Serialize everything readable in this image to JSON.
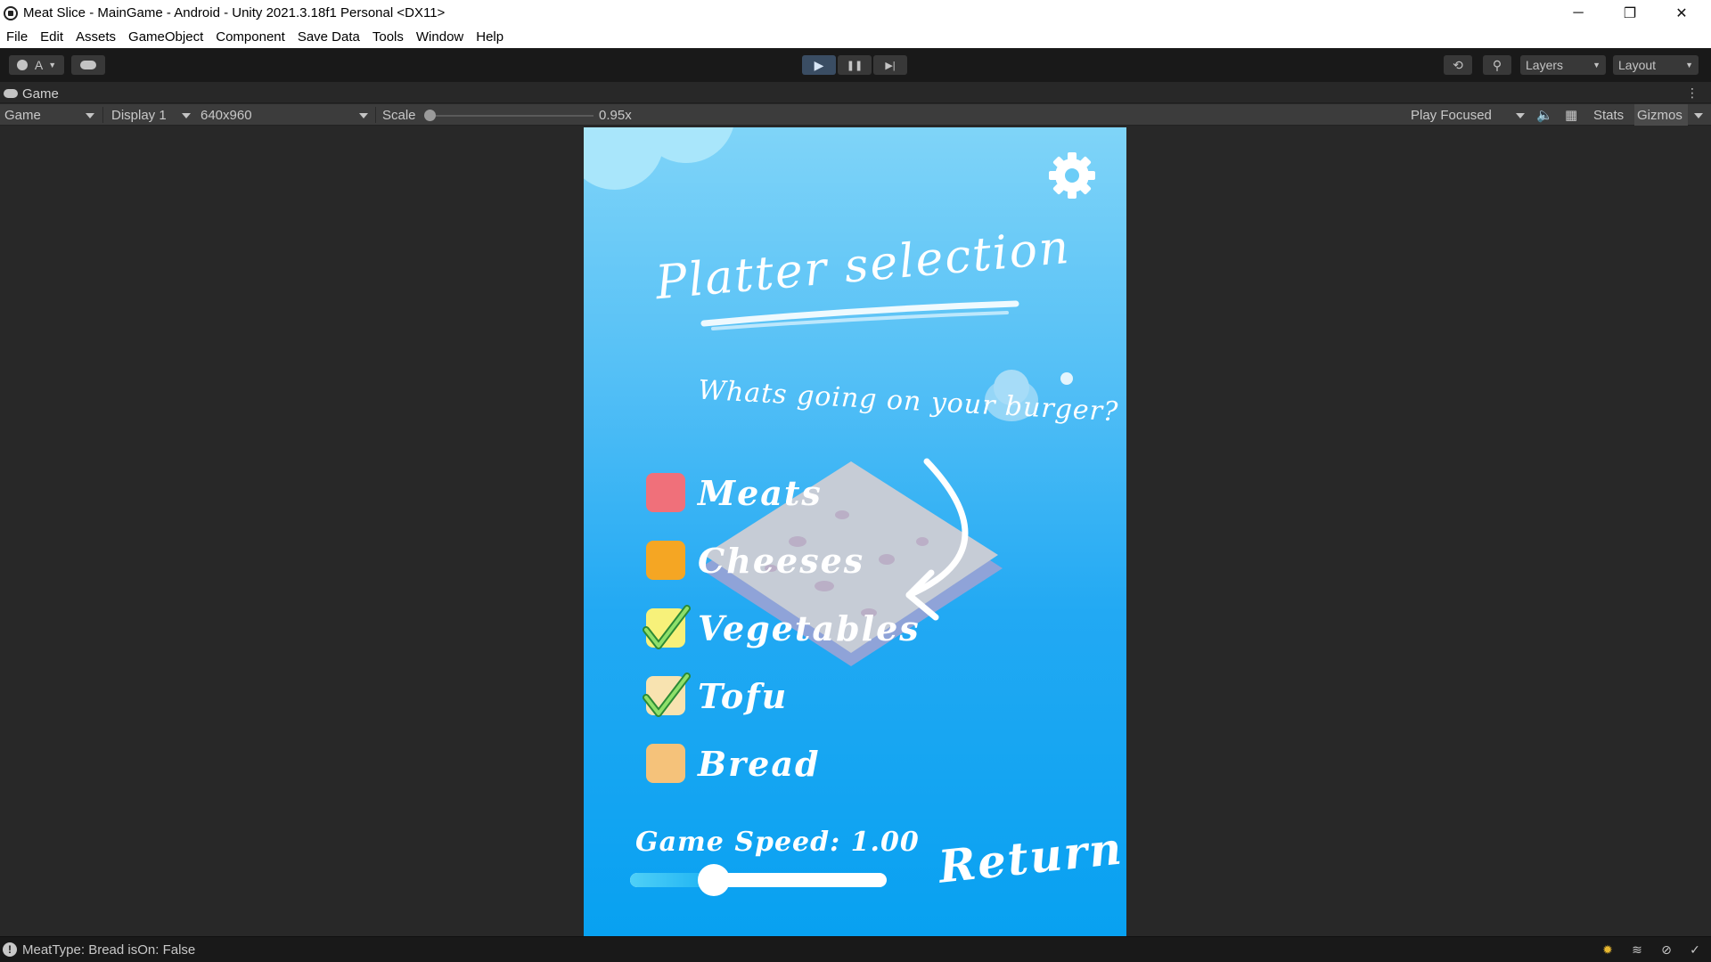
{
  "window": {
    "title": "Meat Slice - MainGame - Android - Unity 2021.3.18f1 Personal <DX11>",
    "controls": {
      "minimize": "─",
      "maximize": "❐",
      "close": "✕"
    }
  },
  "menu": [
    "File",
    "Edit",
    "Assets",
    "GameObject",
    "Component",
    "Save Data",
    "Tools",
    "Window",
    "Help"
  ],
  "toolbar": {
    "account_label": "A",
    "layers_label": "Layers",
    "layout_label": "Layout",
    "play_glyph": "▶",
    "pause_glyph": "❚❚",
    "step_glyph": "▶|"
  },
  "game_tab": {
    "label": "Game"
  },
  "game_toolbar": {
    "view_mode": "Game",
    "display": "Display 1",
    "resolution": "640x960",
    "scale_label": "Scale",
    "scale_value": "0.95x",
    "play_focused": "Play Focused",
    "stats_label": "Stats",
    "gizmos_label": "Gizmos"
  },
  "game": {
    "title": "Platter selection",
    "question": "Whats going on your burger?",
    "options": [
      {
        "label": "Meats",
        "checked": false,
        "color": "#f0707a"
      },
      {
        "label": "Cheeses",
        "checked": false,
        "color": "#f5a623"
      },
      {
        "label": "Vegetables",
        "checked": true,
        "color": "#f7f17a"
      },
      {
        "label": "Tofu",
        "checked": true,
        "color": "#f8e3b0"
      },
      {
        "label": "Bread",
        "checked": false,
        "color": "#f5c27a"
      }
    ],
    "speed_label": "Game Speed: 1.00",
    "speed_value": 1.0,
    "return_label": "Return"
  },
  "status": {
    "message": "MeatType: Bread isOn: False"
  },
  "colors": {
    "accent_blue": "#08a1f1",
    "editor_bg": "#282828",
    "toolbar_bg": "#191919"
  }
}
